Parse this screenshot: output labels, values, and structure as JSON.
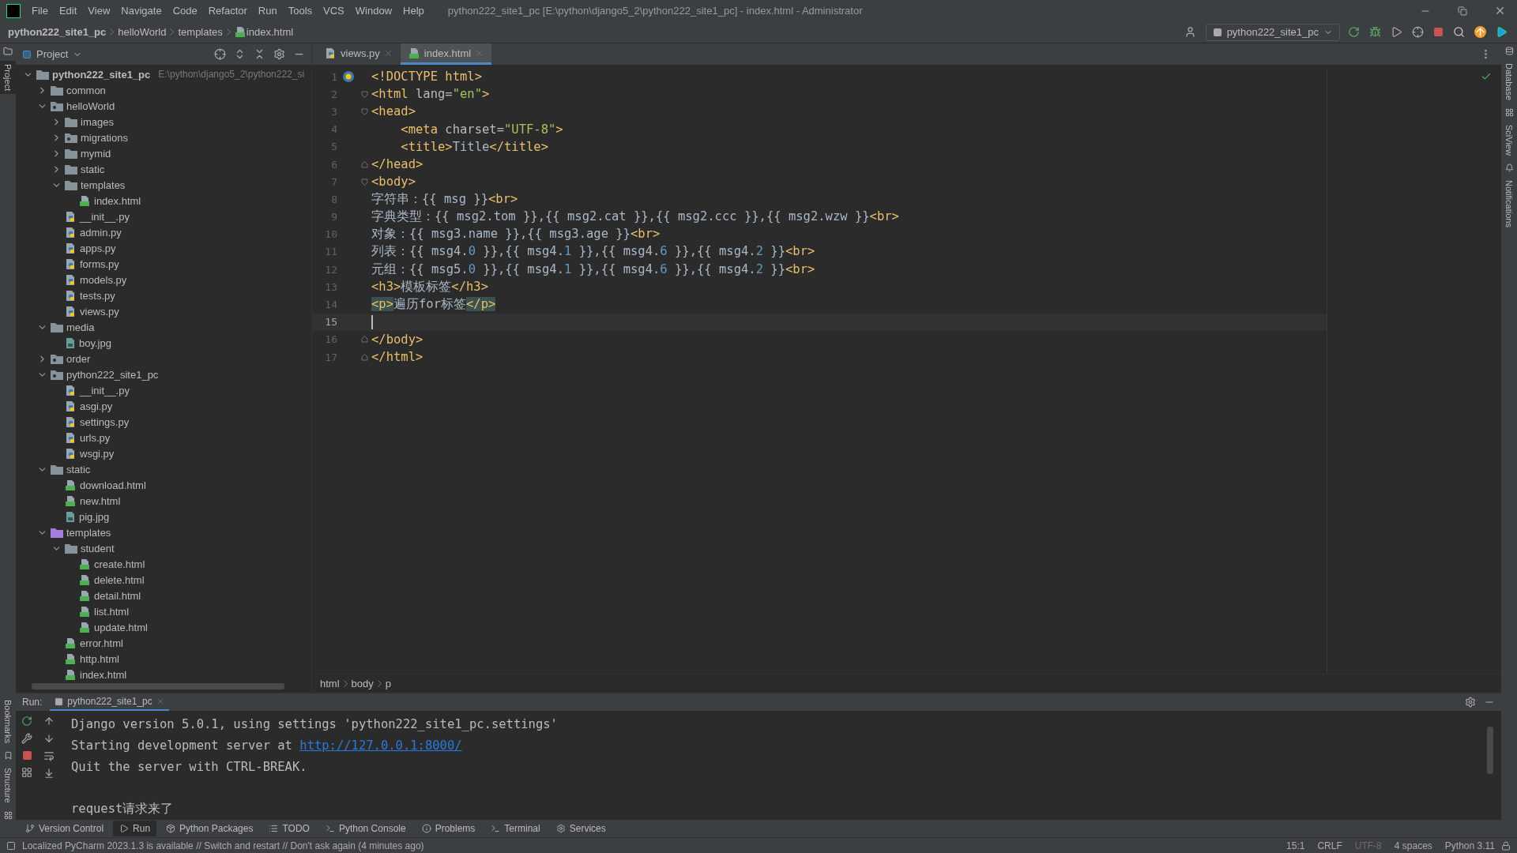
{
  "window": {
    "title": "python222_site1_pc [E:\\python\\django5_2\\python222_site1_pc] - index.html - Administrator"
  },
  "menu": [
    "File",
    "Edit",
    "View",
    "Navigate",
    "Code",
    "Refactor",
    "Run",
    "Tools",
    "VCS",
    "Window",
    "Help"
  ],
  "breadcrumb": [
    "python222_site1_pc",
    "helloWorld",
    "templates",
    "index.html"
  ],
  "run_config": "python222_site1_pc",
  "left_strip": [
    "Project",
    "Bookmarks",
    "Structure"
  ],
  "right_strip": [
    "Database",
    "SciView",
    "Notifications"
  ],
  "project": {
    "header": "Project",
    "root": {
      "name": "python222_site1_pc",
      "kind": "folder",
      "note": "E:\\python\\django5_2\\python222_si",
      "expanded": true,
      "children": [
        {
          "name": "common",
          "kind": "folder",
          "expanded": false
        },
        {
          "name": "helloWorld",
          "kind": "package",
          "expanded": true,
          "children": [
            {
              "name": "images",
              "kind": "folder",
              "expanded": false
            },
            {
              "name": "migrations",
              "kind": "package",
              "expanded": false
            },
            {
              "name": "mymid",
              "kind": "folder",
              "expanded": false
            },
            {
              "name": "static",
              "kind": "folder",
              "expanded": false
            },
            {
              "name": "templates",
              "kind": "folder",
              "expanded": true,
              "children": [
                {
                  "name": "index.html",
                  "kind": "html"
                }
              ]
            },
            {
              "name": "__init__.py",
              "kind": "py"
            },
            {
              "name": "admin.py",
              "kind": "py"
            },
            {
              "name": "apps.py",
              "kind": "py"
            },
            {
              "name": "forms.py",
              "kind": "py"
            },
            {
              "name": "models.py",
              "kind": "py"
            },
            {
              "name": "tests.py",
              "kind": "py"
            },
            {
              "name": "views.py",
              "kind": "py"
            }
          ]
        },
        {
          "name": "media",
          "kind": "folder",
          "expanded": true,
          "children": [
            {
              "name": "boy.jpg",
              "kind": "image"
            }
          ]
        },
        {
          "name": "order",
          "kind": "package",
          "expanded": false
        },
        {
          "name": "python222_site1_pc",
          "kind": "package",
          "expanded": true,
          "children": [
            {
              "name": "__init__.py",
              "kind": "py"
            },
            {
              "name": "asgi.py",
              "kind": "py"
            },
            {
              "name": "settings.py",
              "kind": "py"
            },
            {
              "name": "urls.py",
              "kind": "py"
            },
            {
              "name": "wsgi.py",
              "kind": "py"
            }
          ]
        },
        {
          "name": "static",
          "kind": "folder",
          "expanded": true,
          "children": [
            {
              "name": "download.html",
              "kind": "html"
            },
            {
              "name": "new.html",
              "kind": "html"
            },
            {
              "name": "pig.jpg",
              "kind": "image"
            }
          ]
        },
        {
          "name": "templates",
          "kind": "templates",
          "expanded": true,
          "children": [
            {
              "name": "student",
              "kind": "folder",
              "expanded": true,
              "children": [
                {
                  "name": "create.html",
                  "kind": "html"
                },
                {
                  "name": "delete.html",
                  "kind": "html"
                },
                {
                  "name": "detail.html",
                  "kind": "html"
                },
                {
                  "name": "list.html",
                  "kind": "html"
                },
                {
                  "name": "update.html",
                  "kind": "html"
                }
              ]
            },
            {
              "name": "error.html",
              "kind": "html"
            },
            {
              "name": "http.html",
              "kind": "html"
            },
            {
              "name": "index.html",
              "kind": "html"
            }
          ]
        }
      ]
    }
  },
  "tabs": [
    {
      "label": "views.py",
      "kind": "py",
      "selected": false
    },
    {
      "label": "index.html",
      "kind": "html",
      "selected": true
    }
  ],
  "code": [
    {
      "number": "1",
      "fold_start": false,
      "fold_end": false,
      "current": false,
      "gutter_icon": true,
      "tokens": [
        {
          "kind": "tag",
          "text": "<!DOCTYPE html>"
        }
      ]
    },
    {
      "number": "2",
      "fold_start": true,
      "fold_end": false,
      "current": false,
      "gutter_icon": false,
      "tokens": [
        {
          "kind": "tag",
          "text": "<html"
        },
        {
          "kind": "attr",
          "text": " lang="
        },
        {
          "kind": "string",
          "text": "\"en\""
        },
        {
          "kind": "tag",
          "text": ">"
        }
      ]
    },
    {
      "number": "3",
      "fold_start": true,
      "fold_end": false,
      "current": false,
      "gutter_icon": false,
      "tokens": [
        {
          "kind": "tag",
          "text": "<head>"
        }
      ]
    },
    {
      "number": "4",
      "fold_start": false,
      "fold_end": false,
      "current": false,
      "gutter_icon": false,
      "tokens": [
        {
          "kind": "tag",
          "text": "    <meta"
        },
        {
          "kind": "attr",
          "text": " charset="
        },
        {
          "kind": "string",
          "text": "\"UTF-8\""
        },
        {
          "kind": "tag",
          "text": ">"
        }
      ]
    },
    {
      "number": "5",
      "fold_start": false,
      "fold_end": false,
      "current": false,
      "gutter_icon": false,
      "tokens": [
        {
          "kind": "tag",
          "text": "    <title>"
        },
        {
          "kind": "text",
          "text": "Title"
        },
        {
          "kind": "tag",
          "text": "</title>"
        }
      ]
    },
    {
      "number": "6",
      "fold_start": false,
      "fold_end": true,
      "current": false,
      "gutter_icon": false,
      "tokens": [
        {
          "kind": "tag",
          "text": "</head>"
        }
      ]
    },
    {
      "number": "7",
      "fold_start": true,
      "fold_end": false,
      "current": false,
      "gutter_icon": false,
      "tokens": [
        {
          "kind": "tag",
          "text": "<body>"
        }
      ]
    },
    {
      "number": "8",
      "fold_start": false,
      "fold_end": false,
      "current": false,
      "gutter_icon": false,
      "tokens": [
        {
          "kind": "text",
          "text": "字符串：{{ msg }}"
        },
        {
          "kind": "tag",
          "text": "<br>"
        }
      ]
    },
    {
      "number": "9",
      "fold_start": false,
      "fold_end": false,
      "current": false,
      "gutter_icon": false,
      "tokens": [
        {
          "kind": "text",
          "text": "字典类型：{{ msg2.tom }},{{ msg2.cat }},{{ msg2.ccc }},{{ msg2.wzw }}"
        },
        {
          "kind": "tag",
          "text": "<br>"
        }
      ]
    },
    {
      "number": "10",
      "fold_start": false,
      "fold_end": false,
      "current": false,
      "gutter_icon": false,
      "tokens": [
        {
          "kind": "text",
          "text": "对象：{{ msg3.name }},{{ msg3.age }}"
        },
        {
          "kind": "tag",
          "text": "<br>"
        }
      ]
    },
    {
      "number": "11",
      "fold_start": false,
      "fold_end": false,
      "current": false,
      "gutter_icon": false,
      "tokens": [
        {
          "kind": "text",
          "text": "列表：{{ msg4."
        },
        {
          "kind": "number",
          "text": "0"
        },
        {
          "kind": "text",
          "text": " }},{{ msg4."
        },
        {
          "kind": "number",
          "text": "1"
        },
        {
          "kind": "text",
          "text": " }},{{ msg4."
        },
        {
          "kind": "number",
          "text": "6"
        },
        {
          "kind": "text",
          "text": " }},{{ msg4."
        },
        {
          "kind": "number",
          "text": "2"
        },
        {
          "kind": "text",
          "text": " }}"
        },
        {
          "kind": "tag",
          "text": "<br>"
        }
      ]
    },
    {
      "number": "12",
      "fold_start": false,
      "fold_end": false,
      "current": false,
      "gutter_icon": false,
      "tokens": [
        {
          "kind": "text",
          "text": "元组：{{ msg5."
        },
        {
          "kind": "number",
          "text": "0"
        },
        {
          "kind": "text",
          "text": " }},{{ msg4."
        },
        {
          "kind": "number",
          "text": "1"
        },
        {
          "kind": "text",
          "text": " }},{{ msg4."
        },
        {
          "kind": "number",
          "text": "6"
        },
        {
          "kind": "text",
          "text": " }},{{ msg4."
        },
        {
          "kind": "number",
          "text": "2"
        },
        {
          "kind": "text",
          "text": " }}"
        },
        {
          "kind": "tag",
          "text": "<br>"
        }
      ]
    },
    {
      "number": "13",
      "fold_start": false,
      "fold_end": false,
      "current": false,
      "gutter_icon": false,
      "tokens": [
        {
          "kind": "tag",
          "text": "<h3>"
        },
        {
          "kind": "text",
          "text": "模板标签"
        },
        {
          "kind": "tag",
          "text": "</h3>"
        }
      ]
    },
    {
      "number": "14",
      "fold_start": false,
      "fold_end": false,
      "current": false,
      "gutter_icon": false,
      "tokens": [
        {
          "kind": "tag-match",
          "text": "<p>"
        },
        {
          "kind": "text",
          "text": "遍历for标签"
        },
        {
          "kind": "tag-match",
          "text": "</p>"
        }
      ]
    },
    {
      "number": "15",
      "fold_start": false,
      "fold_end": false,
      "current": true,
      "gutter_icon": false
    },
    {
      "number": "16",
      "fold_start": false,
      "fold_end": true,
      "current": false,
      "gutter_icon": false,
      "tokens": [
        {
          "kind": "tag",
          "text": "</body>"
        }
      ]
    },
    {
      "number": "17",
      "fold_start": false,
      "fold_end": true,
      "current": false,
      "gutter_icon": false,
      "tokens": [
        {
          "kind": "tag",
          "text": "</html>"
        }
      ]
    }
  ],
  "editor_breadcrumb": [
    "html",
    "body",
    "p"
  ],
  "run": {
    "label": "Run:",
    "tab": "python222_site1_pc",
    "lines": [
      {
        "kind": "output",
        "text": "Django version 5.0.1, using settings 'python222_site1_pc.settings'"
      },
      {
        "kind": "output",
        "text": "Starting development server at ",
        "link": "http://127.0.0.1:8000/"
      },
      {
        "kind": "output",
        "text": "Quit the server with CTRL-BREAK."
      },
      {
        "kind": "blank"
      },
      {
        "kind": "output",
        "text": "request请求来了"
      }
    ]
  },
  "tool_windows": [
    {
      "label": "Version Control",
      "kind": "vcs",
      "selected": false
    },
    {
      "label": "Run",
      "kind": "run",
      "selected": true
    },
    {
      "label": "Python Packages",
      "kind": "packages",
      "selected": false
    },
    {
      "label": "TODO",
      "kind": "todo",
      "selected": false
    },
    {
      "label": "Python Console",
      "kind": "console",
      "selected": false
    },
    {
      "label": "Problems",
      "kind": "problems",
      "selected": false
    },
    {
      "label": "Terminal",
      "kind": "terminal",
      "selected": false
    },
    {
      "label": "Services",
      "kind": "services",
      "selected": false
    }
  ],
  "status_bar": {
    "message": "Localized PyCharm 2023.1.3 is available // Switch and restart // Don't ask again (4 minutes ago)",
    "items": [
      {
        "text": "15:1",
        "disabled": false
      },
      {
        "text": "CRLF",
        "disabled": false
      },
      {
        "text": "UTF-8",
        "disabled": true
      },
      {
        "text": "4 spaces",
        "disabled": false
      },
      {
        "text": "Python 3.11",
        "disabled": false
      }
    ]
  }
}
